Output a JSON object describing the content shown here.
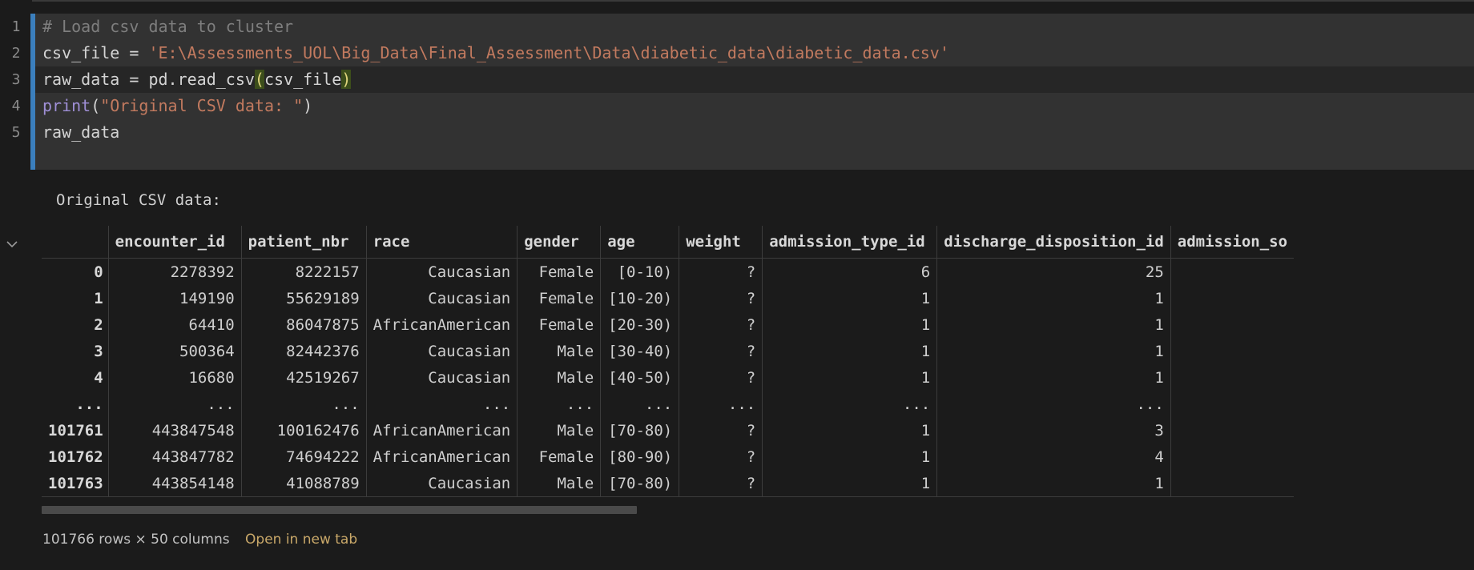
{
  "code": {
    "line_numbers": [
      "1",
      "2",
      "3",
      "4",
      "5"
    ],
    "line1": "# Load csv data to cluster",
    "line2_var": "csv_file = ",
    "line2_str": "'E:\\Assessments_UOL\\Big_Data\\Final_Assessment\\Data\\diabetic_data\\diabetic_data.csv'",
    "line3_pre": "raw_data = pd.read_csv",
    "line3_open": "(",
    "line3_arg": "csv_file",
    "line3_close": ")",
    "line4_kw": "print",
    "line4_open": "(",
    "line4_str": "\"Original CSV data: \"",
    "line4_close": ")",
    "line5": "raw_data"
  },
  "output": {
    "text": "Original CSV data:",
    "table": {
      "columns": [
        "",
        "encounter_id",
        "patient_nbr",
        "race",
        "gender",
        "age",
        "weight",
        "admission_type_id",
        "discharge_disposition_id",
        "admission_so"
      ],
      "rows": [
        [
          "0",
          "2278392",
          "8222157",
          "Caucasian",
          "Female",
          "[0-10)",
          "?",
          "6",
          "25",
          ""
        ],
        [
          "1",
          "149190",
          "55629189",
          "Caucasian",
          "Female",
          "[10-20)",
          "?",
          "1",
          "1",
          ""
        ],
        [
          "2",
          "64410",
          "86047875",
          "AfricanAmerican",
          "Female",
          "[20-30)",
          "?",
          "1",
          "1",
          ""
        ],
        [
          "3",
          "500364",
          "82442376",
          "Caucasian",
          "Male",
          "[30-40)",
          "?",
          "1",
          "1",
          ""
        ],
        [
          "4",
          "16680",
          "42519267",
          "Caucasian",
          "Male",
          "[40-50)",
          "?",
          "1",
          "1",
          ""
        ],
        [
          "...",
          "...",
          "...",
          "...",
          "...",
          "...",
          "...",
          "...",
          "...",
          ""
        ],
        [
          "101761",
          "443847548",
          "100162476",
          "AfricanAmerican",
          "Male",
          "[70-80)",
          "?",
          "1",
          "3",
          ""
        ],
        [
          "101762",
          "443847782",
          "74694222",
          "AfricanAmerican",
          "Female",
          "[80-90)",
          "?",
          "1",
          "4",
          ""
        ],
        [
          "101763",
          "443854148",
          "41088789",
          "Caucasian",
          "Male",
          "[70-80)",
          "?",
          "1",
          "1",
          ""
        ]
      ]
    },
    "summary": "101766 rows × 50 columns",
    "open_tab_label": "Open in new tab"
  }
}
